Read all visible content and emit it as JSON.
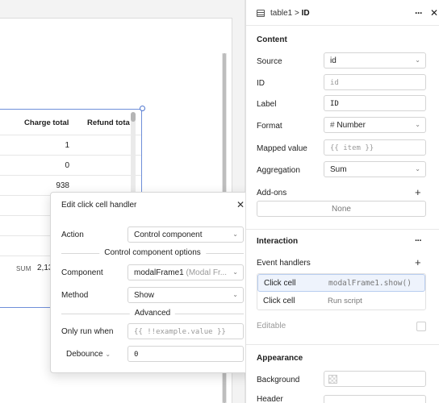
{
  "canvas": {
    "table": {
      "columns": [
        "Charge total",
        "Refund tota"
      ],
      "rows": [
        "1",
        "0",
        "938",
        "",
        "",
        "",
        "",
        ""
      ],
      "sum_label": "SUM",
      "sum_value": "2,13"
    }
  },
  "modal": {
    "title": "Edit click cell handler",
    "close_icon": "✕",
    "action_label": "Action",
    "action_value": "Control component",
    "section_options": "Control component options",
    "component_label": "Component",
    "component_value": "modalFrame1",
    "component_hint": "(Modal Fr...",
    "method_label": "Method",
    "method_value": "Show",
    "section_advanced": "Advanced",
    "only_run_label": "Only run when",
    "only_run_placeholder": "{{ !!example.value }}",
    "debounce_label": "Debounce",
    "debounce_value": "0"
  },
  "inspector": {
    "breadcrumb_parent": "table1",
    "breadcrumb_sep": ">",
    "breadcrumb_current": "ID",
    "content_title": "Content",
    "source_label": "Source",
    "source_value": "id",
    "id_label": "ID",
    "id_placeholder": "id",
    "label_label": "Label",
    "label_value": "ID",
    "format_label": "Format",
    "format_value": "Number",
    "mapped_label": "Mapped value",
    "mapped_placeholder": "{{ item }}",
    "aggregation_label": "Aggregation",
    "aggregation_value": "Sum",
    "addons_label": "Add-ons",
    "addons_none": "None",
    "interaction_title": "Interaction",
    "event_handlers_label": "Event handlers",
    "handlers": [
      {
        "event": "Click cell",
        "action": "modalFrame1.show()"
      },
      {
        "event": "Click cell",
        "action": "Run script"
      }
    ],
    "editable_label": "Editable",
    "appearance_title": "Appearance",
    "background_label": "Background",
    "header_label": "Header"
  },
  "icons": {
    "chevron": "⌄",
    "plus": "+",
    "dots": "···",
    "hash": "#"
  }
}
